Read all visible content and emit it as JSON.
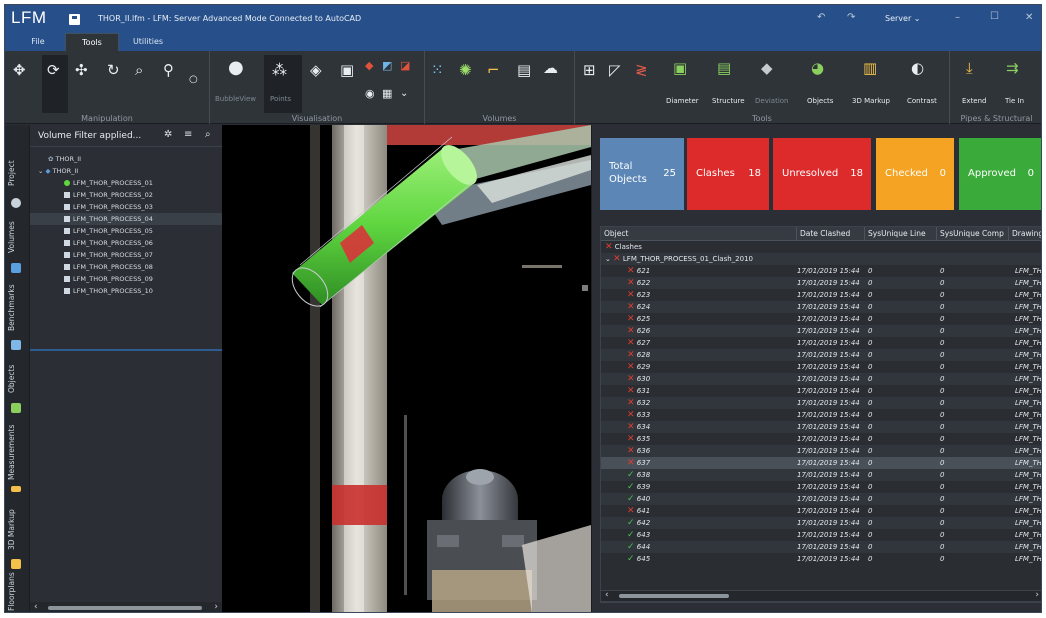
{
  "app": {
    "logo": "LFM",
    "window_title": "THOR_II.lfm - LFM: Server Advanced Mode Connected to AutoCAD",
    "server_label": "Server"
  },
  "menu_tabs": [
    {
      "label": "File",
      "active": false
    },
    {
      "label": "Tools",
      "active": true
    },
    {
      "label": "Utilities",
      "active": false
    }
  ],
  "ribbon": {
    "groups": [
      {
        "label": "Manipulation"
      },
      {
        "label": "Visualisation"
      },
      {
        "label": "Volumes"
      },
      {
        "label": "Tools"
      },
      {
        "label": "Pipes & Structural"
      }
    ],
    "visualisation_items": [
      "BubbleView",
      "Points"
    ],
    "tools_items": [
      "Diameter",
      "Structure",
      "Deviation",
      "Objects",
      "3D Markup",
      "Contrast"
    ],
    "pipes_items": [
      "Extend",
      "Tie In"
    ]
  },
  "side_tabs": [
    "Project",
    "Volumes",
    "Benchmarks",
    "Objects",
    "Measurements",
    "3D Markup",
    "Floorplans"
  ],
  "volume_filter": {
    "title": "Volume Filter applied...",
    "tree": {
      "root": "THOR_II",
      "child": "THOR_II",
      "items": [
        "LFM_THOR_PROCESS_01",
        "LFM_THOR_PROCESS_02",
        "LFM_THOR_PROCESS_03",
        "LFM_THOR_PROCESS_04",
        "LFM_THOR_PROCESS_05",
        "LFM_THOR_PROCESS_06",
        "LFM_THOR_PROCESS_07",
        "LFM_THOR_PROCESS_08",
        "LFM_THOR_PROCESS_09",
        "LFM_THOR_PROCESS_10"
      ],
      "selected_index": 3
    }
  },
  "summary_cards": [
    {
      "label": "Total Objects",
      "count": "25",
      "color": "#5b86b5"
    },
    {
      "label": "Clashes",
      "count": "18",
      "color": "#dd2a2a"
    },
    {
      "label": "Unresolved",
      "count": "18",
      "color": "#dd2a2a"
    },
    {
      "label": "Checked",
      "count": "0",
      "color": "#f4a322"
    },
    {
      "label": "Approved",
      "count": "0",
      "color": "#3aab3a"
    }
  ],
  "grid": {
    "columns": [
      "Object",
      "Date Clashed",
      "SysUnique Line",
      "SysUnique Comp",
      "Drawing"
    ],
    "group_label": "Clashes",
    "subgroup_label": "LFM_THOR_PROCESS_01_Clash_2010",
    "date": "17/01/2019 15:44",
    "line_value": "0",
    "comp_value": "0",
    "drawing_value": "LFM_THO",
    "rows": [
      {
        "id": "621",
        "status": "clash"
      },
      {
        "id": "622",
        "status": "clash"
      },
      {
        "id": "623",
        "status": "clash"
      },
      {
        "id": "624",
        "status": "clash"
      },
      {
        "id": "625",
        "status": "clash"
      },
      {
        "id": "626",
        "status": "clash"
      },
      {
        "id": "627",
        "status": "clash"
      },
      {
        "id": "628",
        "status": "clash"
      },
      {
        "id": "629",
        "status": "clash"
      },
      {
        "id": "630",
        "status": "clash"
      },
      {
        "id": "631",
        "status": "clash"
      },
      {
        "id": "632",
        "status": "clash"
      },
      {
        "id": "633",
        "status": "clash"
      },
      {
        "id": "634",
        "status": "clash"
      },
      {
        "id": "635",
        "status": "clash"
      },
      {
        "id": "636",
        "status": "clash"
      },
      {
        "id": "637",
        "status": "clash",
        "selected": true
      },
      {
        "id": "638",
        "status": "ok"
      },
      {
        "id": "639",
        "status": "ok"
      },
      {
        "id": "640",
        "status": "ok"
      },
      {
        "id": "641",
        "status": "clash"
      },
      {
        "id": "642",
        "status": "ok"
      },
      {
        "id": "643",
        "status": "ok"
      },
      {
        "id": "644",
        "status": "ok"
      },
      {
        "id": "645",
        "status": "ok"
      }
    ]
  },
  "colors": {
    "title_bar": "#27508a",
    "clash_x": "#e23b2e",
    "ok_check": "#49c157",
    "pipe_green": "#5fd640"
  }
}
